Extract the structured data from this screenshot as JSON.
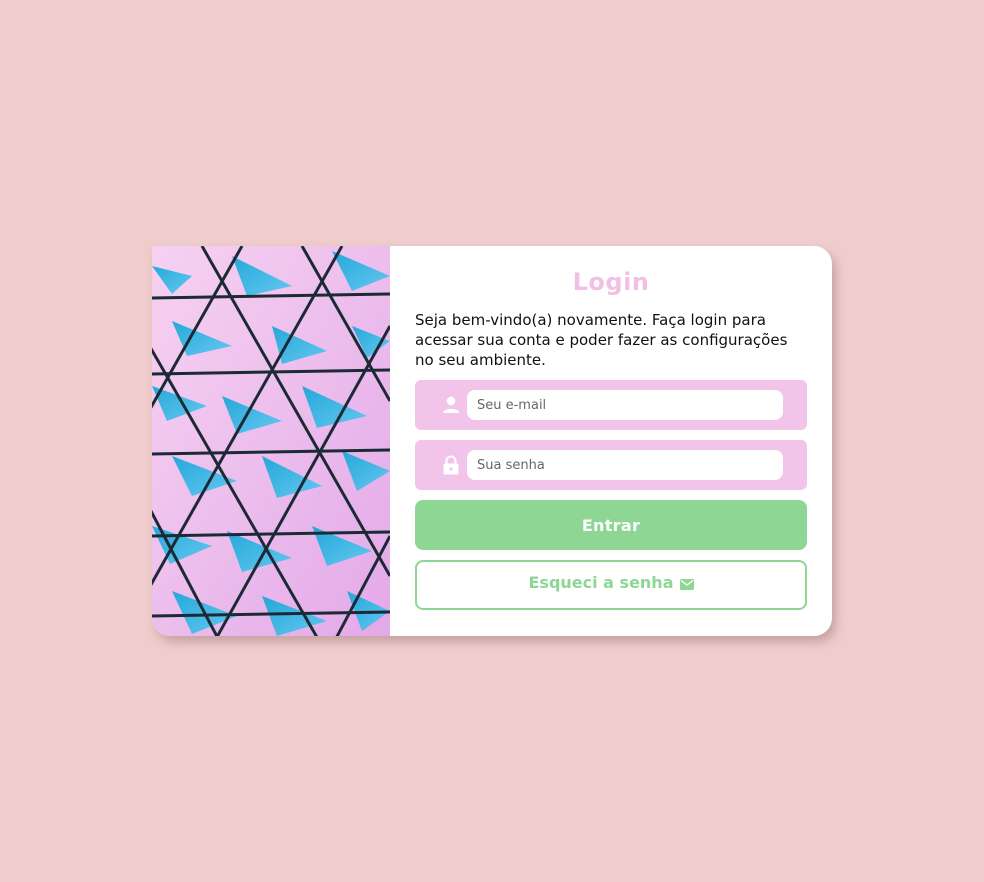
{
  "login": {
    "title": "Login",
    "welcome_text": "Seja bem-vindo(a) novamente. Faça login para acessar sua conta e poder fazer as configurações no seu ambiente.",
    "email_placeholder": "Seu e-mail",
    "password_placeholder": "Sua senha",
    "submit_label": "Entrar",
    "forgot_label": "Esqueci a senha"
  },
  "icons": {
    "email_field": "person-icon",
    "password_field": "lock-icon",
    "forgot_button": "mail-icon"
  },
  "colors": {
    "background": "#f0cdcd",
    "accent_pink": "#f2c4ea",
    "title_pink": "#f2c0e6",
    "accent_green": "#8dd694"
  }
}
